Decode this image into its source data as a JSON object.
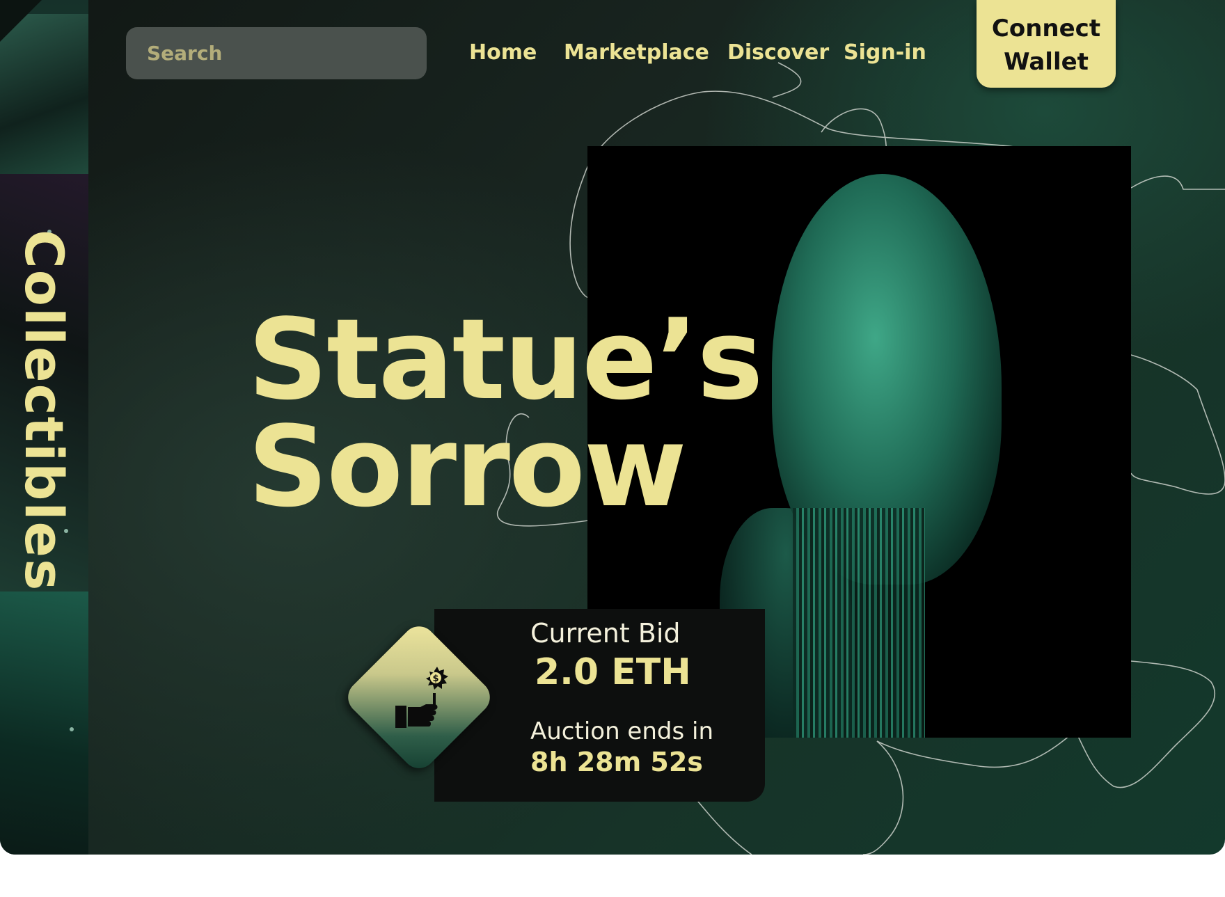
{
  "search": {
    "placeholder": "Search"
  },
  "nav": {
    "items": [
      "Home",
      "Marketplace",
      "Discover",
      "Sign-in"
    ]
  },
  "wallet": {
    "label_line1": "Connect",
    "label_line2": "Wallet"
  },
  "side": {
    "label": "Collectibles"
  },
  "hero": {
    "title_line1": "Statue’s",
    "title_line2": "Sorrow"
  },
  "auction": {
    "bid_label": "Current Bid",
    "bid_value": "2.0 ETH",
    "ends_label": "Auction ends in",
    "ends_value": "8h 28m 52s",
    "icon": "hand-money-icon"
  },
  "colors": {
    "accent": "#ece394",
    "panel": "#0d0f0e",
    "background": "#15261f"
  }
}
